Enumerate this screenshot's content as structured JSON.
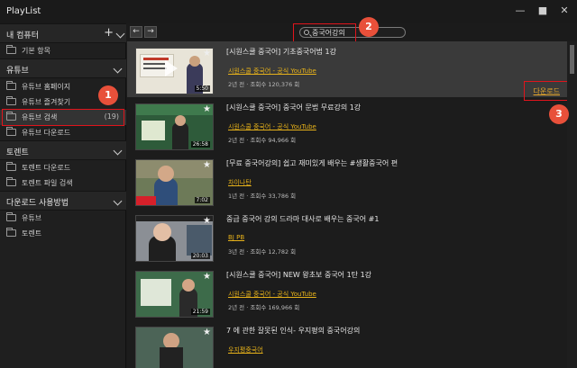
{
  "window": {
    "title": "PlayList",
    "minimize": "—",
    "maximize": "■",
    "close": "✕"
  },
  "sidebar": {
    "my_computer": {
      "label": "내 컴퓨터",
      "plus": "+",
      "items": [
        {
          "label": "기본 항목"
        }
      ]
    },
    "youtube": {
      "label": "유튜브",
      "items": [
        {
          "label": "유튜브 홈페이지"
        },
        {
          "label": "유튜브 즐겨찾기"
        },
        {
          "label": "유튜브 검색",
          "count": "(19)"
        },
        {
          "label": "유튜브 다운로드"
        }
      ]
    },
    "torrent": {
      "label": "토렌트",
      "items": [
        {
          "label": "토렌트 다운로드"
        },
        {
          "label": "토렌트 파일 검색"
        }
      ]
    },
    "howto": {
      "label": "다운로드 사용방법",
      "items": [
        {
          "label": "유튜브"
        },
        {
          "label": "토렌트"
        }
      ]
    }
  },
  "toolbar": {
    "back": "←",
    "forward": "→",
    "search_value": "중국어강의"
  },
  "badges": {
    "b1": "1",
    "b2": "2",
    "b3": "3"
  },
  "videos": [
    {
      "title": "[시원스쿨 중국어] 기초중국어법 1강",
      "channel": "시원스쿨 중국어 - 공식 YouTube",
      "meta": "2년 전 · 조회수 120,376 회",
      "duration": "5:50",
      "download": "다운로드"
    },
    {
      "title": "[시원스쿨 중국어] 중국어 문법 무료강의 1강",
      "channel": "시원스쿨 중국어 - 공식 YouTube",
      "meta": "2년 전 · 조회수 94,966 회",
      "duration": "26:58"
    },
    {
      "title": "[무료 중국어강의] 쉽고 재미있게 배우는 #생활중국어 편",
      "channel": "차이나탄",
      "meta": "1년 전 · 조회수 33,786 회",
      "duration": "7:02"
    },
    {
      "title": "중급 중국어 강의 드라마 대사로 배우는 중국어 #1",
      "channel": "BJ PB",
      "meta": "3년 전 · 조회수 12,782 회",
      "duration": "20:03"
    },
    {
      "title": "[시원스쿨 중국어] NEW 왕초보 중국어 1탄 1강",
      "channel": "시원스쿨 중국어 - 공식 YouTube",
      "meta": "2년 전 · 조회수 169,966 회",
      "duration": "21:59"
    },
    {
      "title": "7 에 관한 잘못된 인식- 우지평의 중국어강의",
      "channel": "우지평중국어",
      "meta": "",
      "duration": ""
    }
  ]
}
